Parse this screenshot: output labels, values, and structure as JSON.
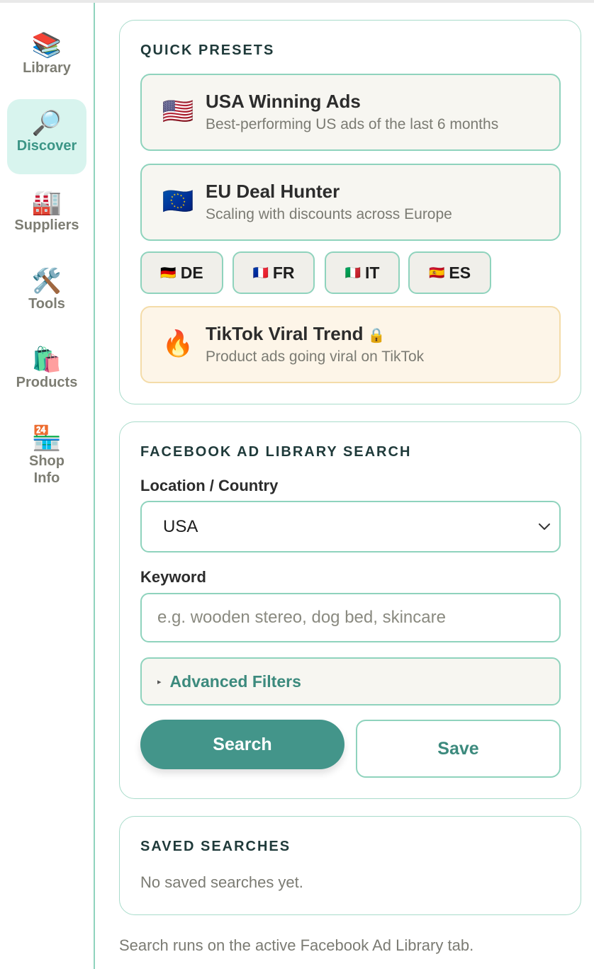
{
  "sidebar": {
    "items": [
      {
        "icon": "📚",
        "icon_name": "books-icon",
        "label": "Library",
        "active": false
      },
      {
        "icon": "🔎",
        "icon_name": "magnifier-icon",
        "label": "Discover",
        "active": true
      },
      {
        "icon": "🏭",
        "icon_name": "factory-icon",
        "label": "Suppliers",
        "active": false
      },
      {
        "icon": "🛠️",
        "icon_name": "hammer-wrench-icon",
        "label": "Tools",
        "active": false
      },
      {
        "icon": "🛍️",
        "icon_name": "shopping-bags-icon",
        "label": "Products",
        "active": false
      },
      {
        "icon": "🏪",
        "icon_name": "convenience-store-icon",
        "label": "Shop Info",
        "active": false
      }
    ]
  },
  "quick_presets": {
    "title": "QUICK PRESETS",
    "presets": [
      {
        "flag": "🇺🇸",
        "icon_name": "us-flag-icon",
        "title": "USA Winning Ads",
        "subtitle": "Best-performing US ads of the last 6 months"
      },
      {
        "flag": "🇪🇺",
        "icon_name": "eu-flag-icon",
        "title": "EU Deal Hunter",
        "subtitle": "Scaling with discounts across Europe"
      }
    ],
    "countries": [
      {
        "flag": "🇩🇪",
        "icon_name": "de-flag-icon",
        "code": "DE"
      },
      {
        "flag": "🇫🇷",
        "icon_name": "fr-flag-icon",
        "code": "FR"
      },
      {
        "flag": "🇮🇹",
        "icon_name": "it-flag-icon",
        "code": "IT"
      },
      {
        "flag": "🇪🇸",
        "icon_name": "es-flag-icon",
        "code": "ES"
      }
    ],
    "tiktok": {
      "icon": "🔥",
      "icon_name": "fire-icon",
      "title": "TikTok Viral Trend",
      "lock": "🔒",
      "subtitle": "Product ads going viral on TikTok"
    }
  },
  "search": {
    "title": "FACEBOOK AD LIBRARY SEARCH",
    "location_label": "Location / Country",
    "location_value": "USA",
    "keyword_label": "Keyword",
    "keyword_placeholder": "e.g. wooden stereo, dog bed, skincare",
    "keyword_value": "",
    "advanced_label": "Advanced Filters",
    "advanced_marker": "▸",
    "search_button": "Search",
    "save_button": "Save"
  },
  "saved": {
    "title": "SAVED SEARCHES",
    "empty_message": "No saved searches yet."
  },
  "footer_note": "Search runs on the active Facebook Ad Library tab.",
  "colors": {
    "accent": "#43958a",
    "border": "#8fd3bd",
    "active_bg": "#d8f4ee"
  }
}
